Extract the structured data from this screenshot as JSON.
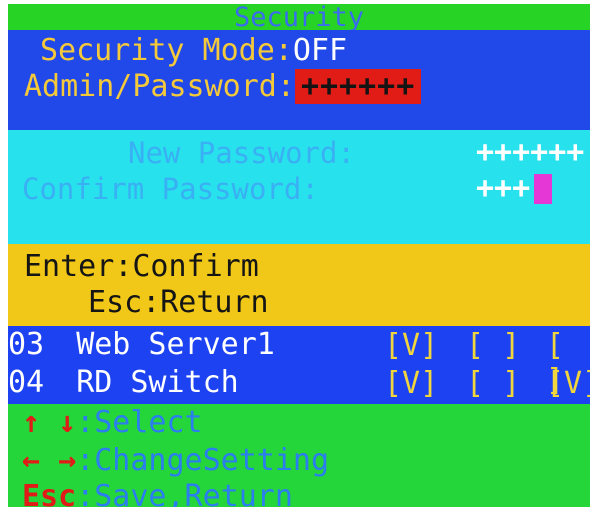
{
  "title": "Security",
  "security_mode": {
    "label": "Security Mode:",
    "value": "OFF"
  },
  "admin_password": {
    "label": "Admin/Password:",
    "value": "++++++"
  },
  "password_dialog": {
    "new_label": "New Password:",
    "new_value": "++++++",
    "confirm_label": "Confirm Password:",
    "confirm_value": "+++"
  },
  "controls": [
    {
      "key": "Enter",
      "sep": ":",
      "action": "Confirm"
    },
    {
      "key": "Esc",
      "sep": ":",
      "action": "Return"
    }
  ],
  "servers": [
    {
      "number": "03",
      "name": "Web Server1",
      "checks": [
        "[V]",
        "[ ]",
        "[ ]"
      ]
    },
    {
      "number": "04",
      "name": "RD Switch",
      "checks": [
        "[V]",
        "[ ]",
        "[V]"
      ]
    }
  ],
  "footer": [
    {
      "keys": "↑ ↓",
      "sep": ":",
      "text": "Select"
    },
    {
      "keys": "← →",
      "sep": ":",
      "text": "ChangeSetting"
    },
    {
      "keys": "Esc",
      "sep": ":",
      "text": "Save,Return"
    }
  ],
  "colors": {
    "title_band": "#27d324",
    "main_band": "#2148e8",
    "dialog_band": "#27e1ec",
    "controls_band": "#f1c817",
    "footer_band": "#25d63a",
    "password_highlight": "#e11c16",
    "cursor": "#e437d5"
  }
}
